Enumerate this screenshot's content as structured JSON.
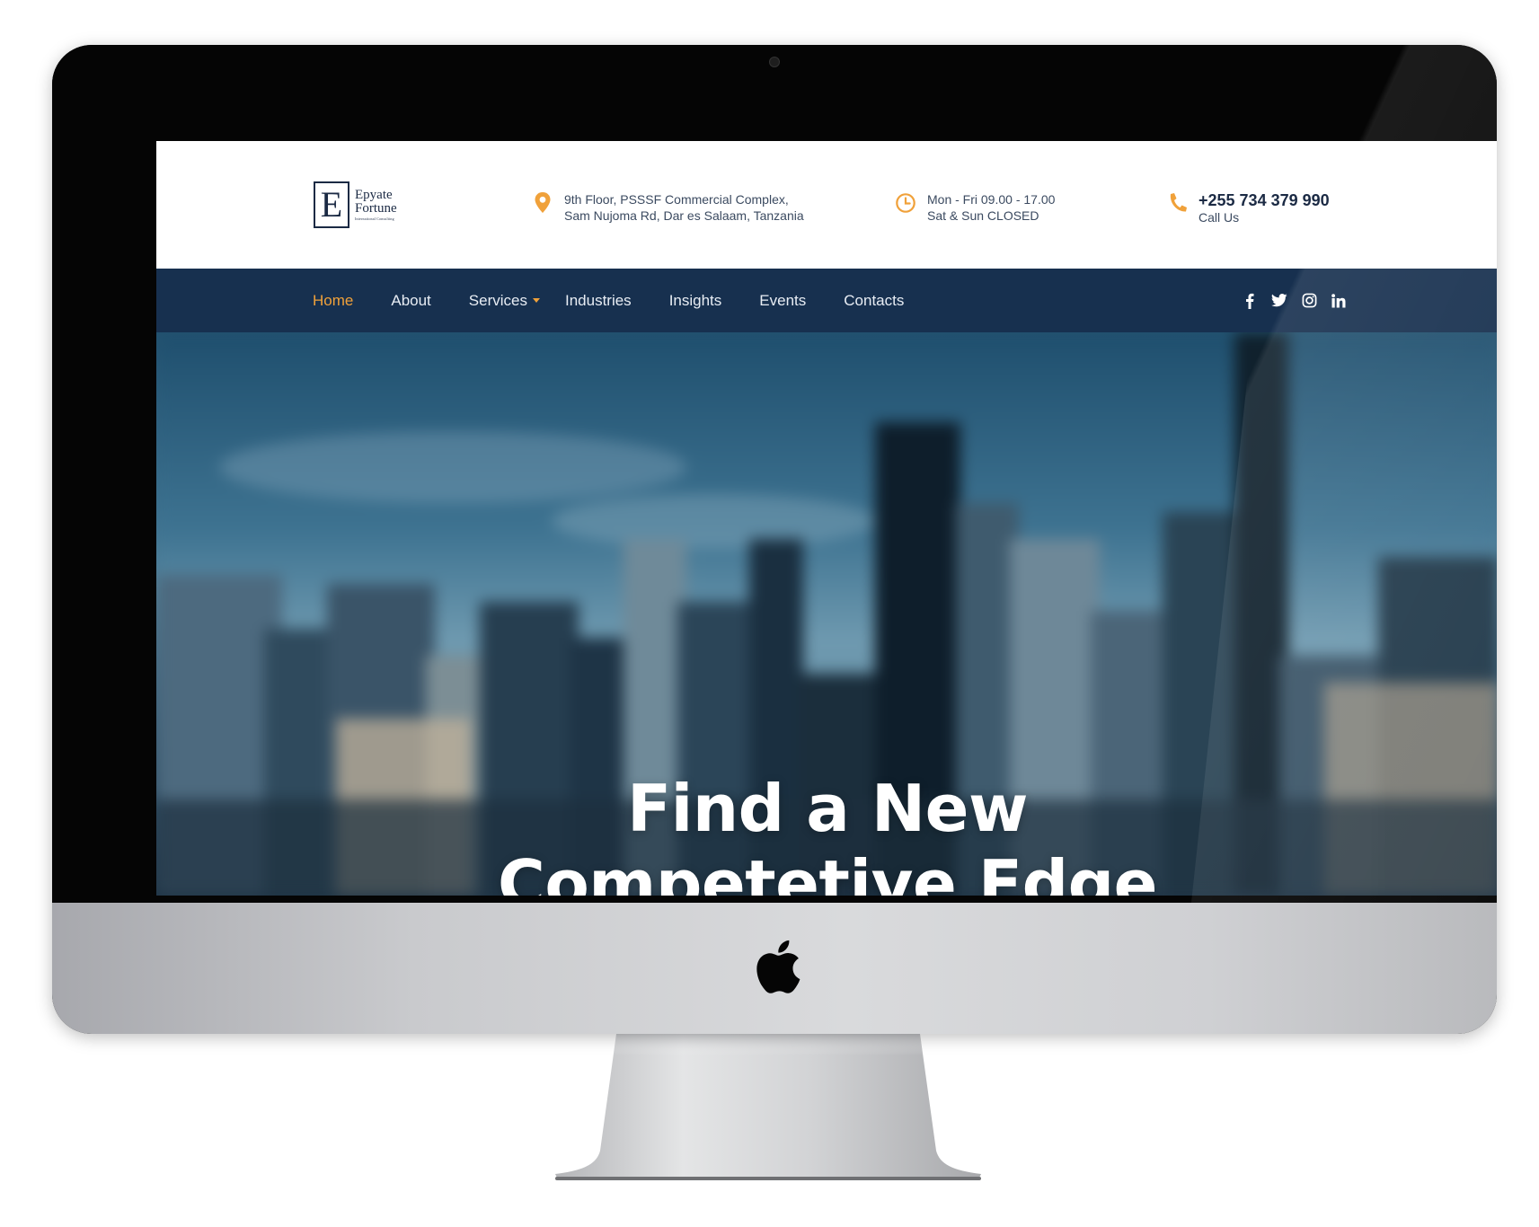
{
  "brand": {
    "logo_letter": "E",
    "logo_line1": "Epyate",
    "logo_line2": "Fortune",
    "logo_line3": "International Consulting"
  },
  "contact": {
    "address_line1": "9th Floor, PSSSF Commercial Complex,",
    "address_line2": "Sam Nujoma Rd, Dar es Salaam, Tanzania",
    "hours_line1": "Mon - Fri 09.00 - 17.00",
    "hours_line2": "Sat & Sun CLOSED",
    "phone": "+255 734 379 990",
    "phone_label": "Call Us"
  },
  "nav": {
    "items": [
      {
        "label": "Home",
        "active": true
      },
      {
        "label": "About"
      },
      {
        "label": "Services",
        "dropdown": true
      },
      {
        "label": "Industries"
      },
      {
        "label": "Insights"
      },
      {
        "label": "Events"
      },
      {
        "label": "Contacts"
      }
    ],
    "social": [
      "facebook-icon",
      "twitter-icon",
      "instagram-icon",
      "linkedin-icon"
    ]
  },
  "hero": {
    "title_line1": "Find a New",
    "title_line2": "Competetive Edge"
  },
  "colors": {
    "accent": "#f0a13a",
    "navbar": "#17304f",
    "brand_dark": "#1b2a44"
  }
}
